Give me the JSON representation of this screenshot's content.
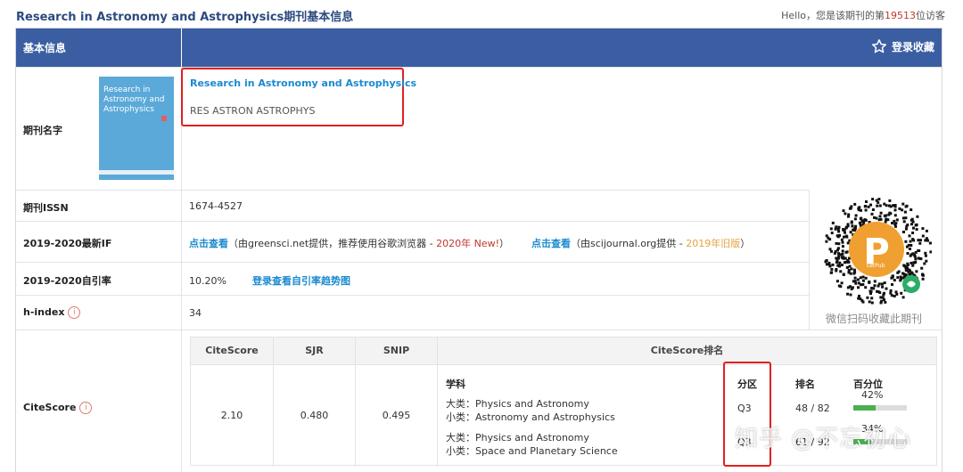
{
  "top": {
    "title": "Research in Astronomy and Astrophysics期刊基本信息",
    "visitor_prefix": "Hello，您是该期刊的第",
    "visitor_count": "19513",
    "visitor_suffix": "位访客"
  },
  "header": {
    "section_label": "基本信息",
    "favorite_label": "登录收藏"
  },
  "journal": {
    "label": "期刊名字",
    "cover_title": "Research in Astronomy and Astrophysics",
    "name": "Research in Astronomy and Astrophysics",
    "abbr": "RES ASTRON ASTROPHYS"
  },
  "issn": {
    "label": "期刊ISSN",
    "value": "1674-4527"
  },
  "impact": {
    "label": "2019-2020最新IF",
    "link1": "点击查看",
    "src1": "（由greensci.net提供，推荐使用谷歌浏览器 - ",
    "tag1": "2020年 New!",
    "end1": "）",
    "link2": "点击查看",
    "src2": "（由scijournal.org提供 - ",
    "tag2": "2019年旧版",
    "end2": "）"
  },
  "selfcite": {
    "label": "2019-2020自引率",
    "value": "10.20%",
    "link": "登录查看自引率趋势图"
  },
  "hindex": {
    "label": "h-index",
    "value": "34",
    "info": "i"
  },
  "qr": {
    "caption": "微信扫码收藏此期刊",
    "brand": "LetPub"
  },
  "citescore": {
    "label": "CiteScore",
    "headers": {
      "citescore": "CiteScore",
      "sjr": "SJR",
      "snip": "SNIP",
      "rank": "CiteScore排名"
    },
    "values": {
      "citescore": "2.10",
      "sjr": "0.480",
      "snip": "0.495"
    },
    "rank_headers": {
      "subject": "学科",
      "zone": "分区",
      "rank": "排名",
      "percentile": "百分位"
    },
    "rows": [
      {
        "major_label": "大类：",
        "major": "Physics and Astronomy",
        "minor_label": "小类：",
        "minor": "Astronomy and Astrophysics",
        "zone": "Q3",
        "rank": "48 / 82",
        "percentile_text": "42%",
        "percentile": 0.42
      },
      {
        "major_label": "大类：",
        "major": "Physics and Astronomy",
        "minor_label": "小类：",
        "minor": "Space and Planetary Science",
        "zone": "Q3",
        "rank": "61 / 92",
        "percentile_text": "34%",
        "percentile": 0.34
      }
    ]
  },
  "watermark": "知乎 @不忘初心",
  "colors": {
    "header_bg": "#3b5ea3",
    "link": "#1a8ad0",
    "highlight": "#e02020",
    "progress": "#4caf50"
  }
}
